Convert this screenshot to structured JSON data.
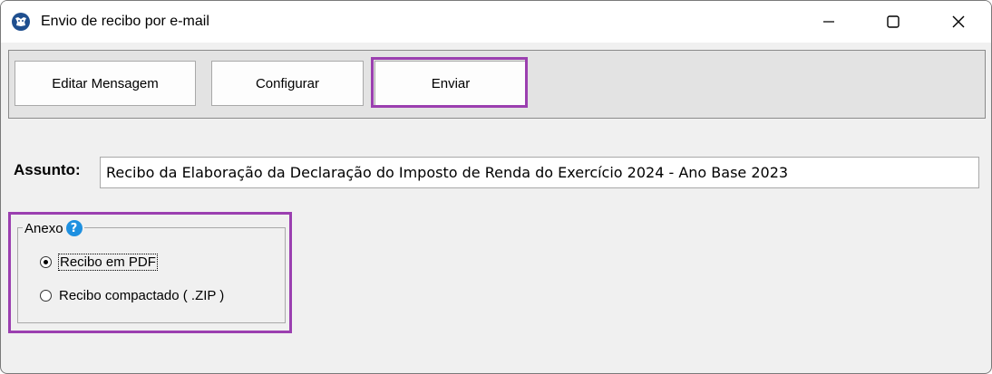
{
  "window": {
    "title": "Envio de recibo por e-mail",
    "app_icon": "app-logo-icon",
    "controls": [
      "minimize-icon",
      "maximize-icon",
      "close-icon"
    ]
  },
  "toolbar": {
    "edit_message_label": "Editar Mensagem",
    "configure_label": "Configurar",
    "send_label": "Enviar"
  },
  "subject": {
    "label": "Assunto:",
    "value": "Recibo da Elaboração da Declaração do Imposto de Renda do Exercício 2024 - Ano Base 2023"
  },
  "attachment": {
    "legend": "Anexo",
    "help_icon": "help-icon",
    "options": [
      {
        "label": "Recibo em PDF",
        "selected": true
      },
      {
        "label": "Recibo compactado ( .ZIP )",
        "selected": false
      }
    ]
  },
  "colors": {
    "highlight": "#9b3fb0",
    "help_icon": "#1e90e0",
    "app_icon": "#1f4f8f"
  }
}
